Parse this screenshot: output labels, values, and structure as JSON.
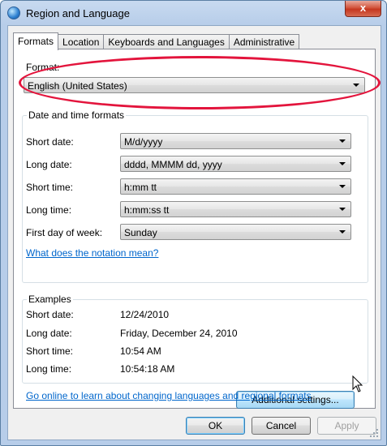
{
  "window": {
    "title": "Region and Language",
    "close_glyph": "x"
  },
  "tabs": [
    {
      "label": "Formats",
      "active": true
    },
    {
      "label": "Location",
      "active": false
    },
    {
      "label": "Keyboards and Languages",
      "active": false
    },
    {
      "label": "Administrative",
      "active": false
    }
  ],
  "format": {
    "label": "Format:",
    "value": "English (United States)"
  },
  "datetime": {
    "title": "Date and time formats",
    "rows": [
      {
        "label": "Short date:",
        "value": "M/d/yyyy"
      },
      {
        "label": "Long date:",
        "value": "dddd, MMMM dd, yyyy"
      },
      {
        "label": "Short time:",
        "value": "h:mm tt"
      },
      {
        "label": "Long time:",
        "value": "h:mm:ss tt"
      },
      {
        "label": "First day of week:",
        "value": "Sunday"
      }
    ],
    "notation_link": "What does the notation mean?"
  },
  "examples": {
    "title": "Examples",
    "rows": [
      {
        "label": "Short date:",
        "value": "12/24/2010"
      },
      {
        "label": "Long date:",
        "value": "Friday, December 24, 2010"
      },
      {
        "label": "Short time:",
        "value": "10:54 AM"
      },
      {
        "label": "Long time:",
        "value": "10:54:18 AM"
      }
    ]
  },
  "additional_settings_label": "Additional settings...",
  "online_link": "Go online to learn about changing languages and regional formats",
  "footer": {
    "ok": "OK",
    "cancel": "Cancel",
    "apply": "Apply"
  },
  "colors": {
    "highlight": "#e3143c",
    "link": "#0066cc",
    "title_bar": "#b7cde9"
  }
}
